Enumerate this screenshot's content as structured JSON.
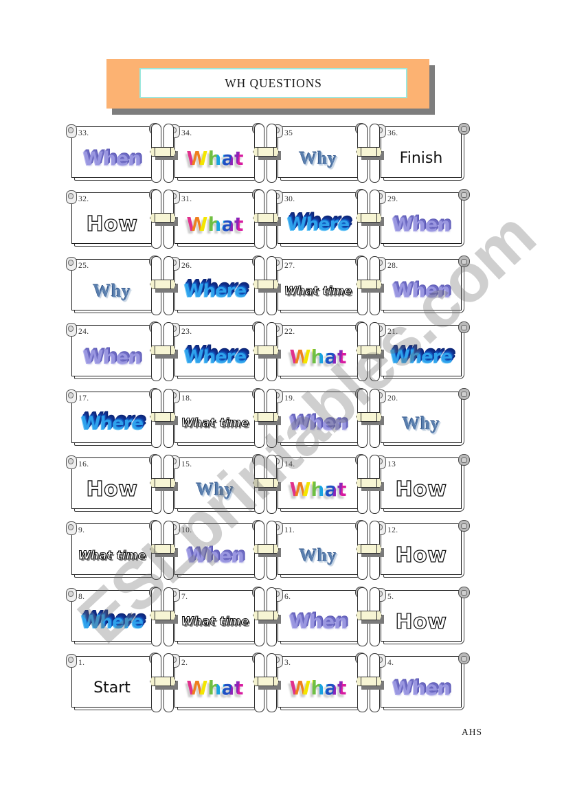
{
  "banner": {
    "title": "WH QUESTIONS",
    "fill_color": "#FCB272",
    "inner_border_color": "#9BE7DD",
    "shadow_color": "#7D7D7D"
  },
  "watermark": {
    "text": "ESLprintables.com",
    "color": "#6E6E6E"
  },
  "footer": {
    "credit": "AHS"
  },
  "styles": {
    "when": "#9A97E0",
    "what": "rainbow",
    "where": "#2FA2EC",
    "how": "outline-black",
    "why": "#5A7FAE",
    "what_time": "white-outline-italic",
    "plain": "#111111"
  },
  "board": {
    "columns": 4,
    "rows": 9,
    "cells": [
      [
        {
          "number": "33.",
          "word": "When",
          "style": "w-when"
        },
        {
          "number": "34.",
          "word": "What",
          "style": "w-what"
        },
        {
          "number": "35",
          "word": "Why",
          "style": "w-why"
        },
        {
          "number": "36.",
          "word": "Finish",
          "style": "w-plain"
        }
      ],
      [
        {
          "number": "32.",
          "word": "How",
          "style": "w-how"
        },
        {
          "number": "31.",
          "word": "What",
          "style": "w-what"
        },
        {
          "number": "30.",
          "word": "Where",
          "style": "w-where"
        },
        {
          "number": "29.",
          "word": "When",
          "style": "w-when"
        }
      ],
      [
        {
          "number": "25.",
          "word": "Why",
          "style": "w-why"
        },
        {
          "number": "26.",
          "word": "Where",
          "style": "w-where"
        },
        {
          "number": "27.",
          "word": "What time",
          "style": "w-whattime"
        },
        {
          "number": "28.",
          "word": "When",
          "style": "w-when"
        }
      ],
      [
        {
          "number": "24.",
          "word": "When",
          "style": "w-when"
        },
        {
          "number": "23.",
          "word": "Where",
          "style": "w-where"
        },
        {
          "number": "22.",
          "word": "What",
          "style": "w-what"
        },
        {
          "number": "21.",
          "word": "Where",
          "style": "w-where"
        }
      ],
      [
        {
          "number": "17.",
          "word": "Where",
          "style": "w-where"
        },
        {
          "number": "18.",
          "word": "What time",
          "style": "w-whattime"
        },
        {
          "number": "19.",
          "word": "When",
          "style": "w-when"
        },
        {
          "number": "20.",
          "word": "Why",
          "style": "w-why"
        }
      ],
      [
        {
          "number": "16.",
          "word": "How",
          "style": "w-how"
        },
        {
          "number": "15.",
          "word": "Why",
          "style": "w-why"
        },
        {
          "number": "14.",
          "word": "What",
          "style": "w-what"
        },
        {
          "number": "13",
          "word": "How",
          "style": "w-how"
        }
      ],
      [
        {
          "number": "9.",
          "word": "What time",
          "style": "w-whattime"
        },
        {
          "number": "10.",
          "word": "When",
          "style": "w-when"
        },
        {
          "number": "11.",
          "word": "Why",
          "style": "w-why"
        },
        {
          "number": "12.",
          "word": "How",
          "style": "w-how"
        }
      ],
      [
        {
          "number": "8.",
          "word": "Where",
          "style": "w-where"
        },
        {
          "number": "7.",
          "word": "What time",
          "style": "w-whattime"
        },
        {
          "number": "6.",
          "word": "When",
          "style": "w-when"
        },
        {
          "number": "5.",
          "word": "How",
          "style": "w-how"
        }
      ],
      [
        {
          "number": "1.",
          "word": "Start",
          "style": "w-plain"
        },
        {
          "number": "2.",
          "word": "What",
          "style": "w-what"
        },
        {
          "number": "3.",
          "word": "What",
          "style": "w-what"
        },
        {
          "number": "4.",
          "word": "When",
          "style": "w-when"
        }
      ]
    ]
  }
}
